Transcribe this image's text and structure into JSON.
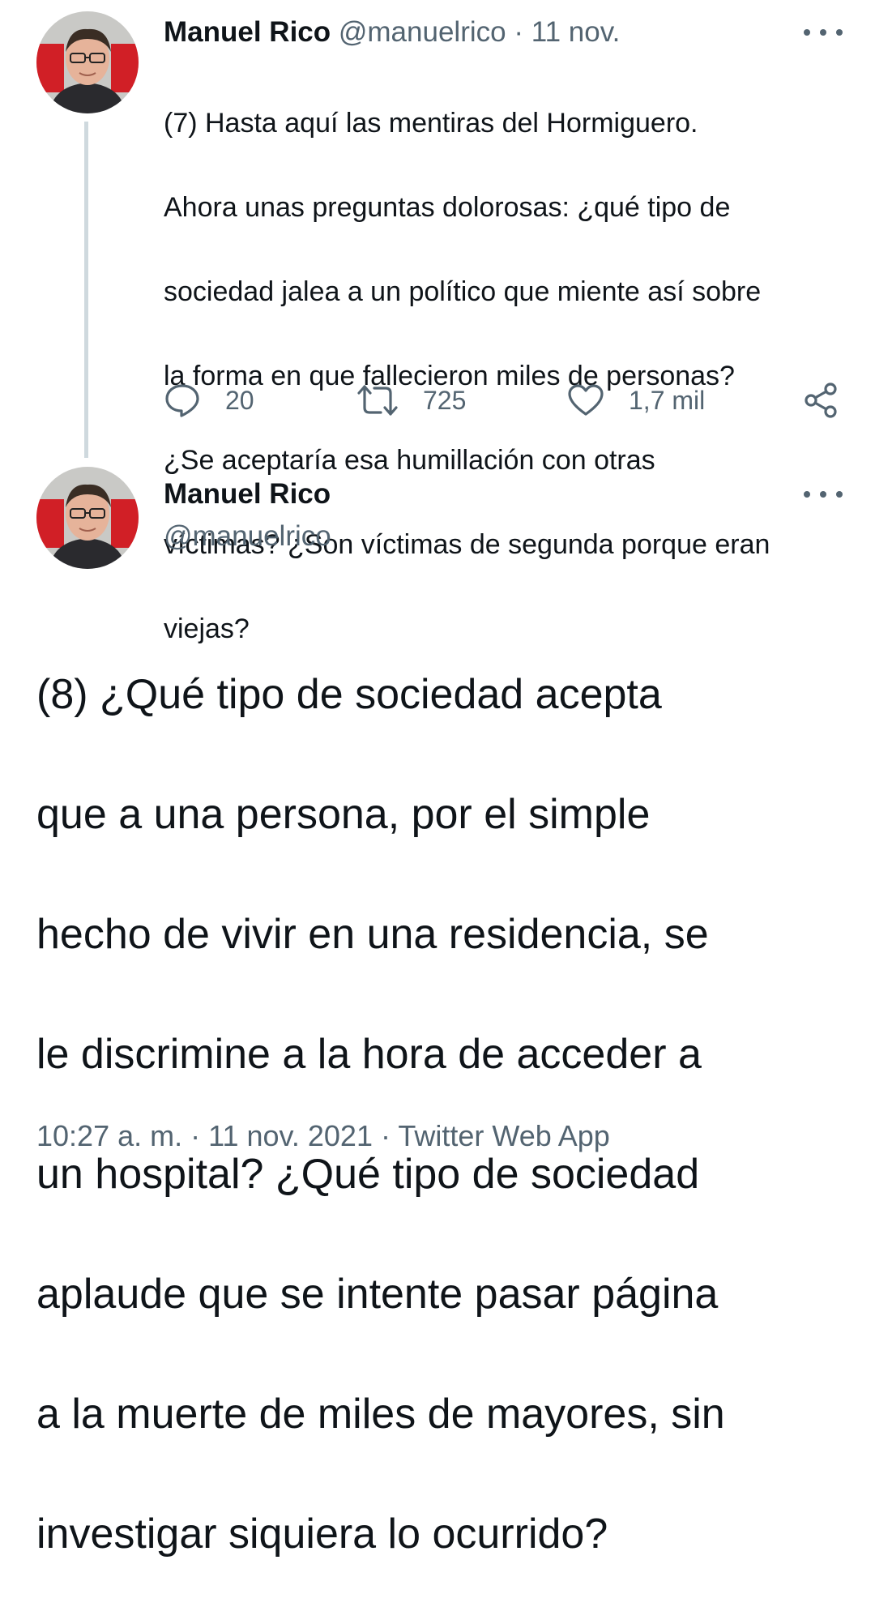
{
  "tweet1": {
    "author_name": "Manuel Rico",
    "handle": "@manuelrico",
    "separator": "·",
    "date": "11 nov.",
    "lines": [
      "(7) Hasta aquí las mentiras del Hormiguero.",
      "Ahora unas preguntas dolorosas: ¿qué tipo de",
      "sociedad jalea a un político que miente así sobre",
      "la forma en que fallecieron miles de personas?",
      "¿Se aceptaría esa humillación con otras",
      "víctimas? ¿Son víctimas de segunda porque eran",
      "viejas?"
    ],
    "reply_count": "20",
    "retweet_count": "725",
    "like_count": "1,7 mil"
  },
  "tweet2": {
    "author_name": "Manuel Rico",
    "handle": "@manuelrico",
    "lines": [
      "(8) ¿Qué tipo de sociedad acepta",
      "que a una persona, por el simple",
      "hecho de vivir en una residencia, se",
      "le discrimine a la hora de acceder a",
      "un hospital? ¿Qué tipo de sociedad",
      "aplaude que se intente pasar página",
      "a la muerte de miles de mayores, sin",
      "investigar siquiera lo ocurrido?"
    ],
    "time": "10:27 a. m.",
    "separator": "·",
    "date": "11 nov. 2021",
    "source": "Twitter Web App"
  },
  "icons": {
    "reply": "reply-icon",
    "retweet": "retweet-icon",
    "like": "heart-icon",
    "share": "share-icon",
    "more": "more-options-icon"
  },
  "colors": {
    "text": "#0f1419",
    "muted": "#536471",
    "thread_line": "#cfd9de",
    "background": "#ffffff"
  }
}
